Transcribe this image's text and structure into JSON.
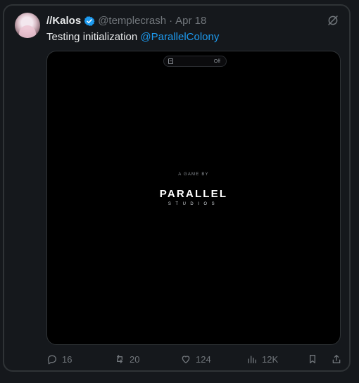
{
  "tweet": {
    "display_name": "//Kalos",
    "handle": "@templecrash",
    "separator": "·",
    "date": "Apr 18",
    "text_prefix": "Testing initialization ",
    "mention": "@ParallelColony"
  },
  "media": {
    "pill_status": "Off",
    "kicker": "A GAME BY",
    "brand": "PARALLEL",
    "studios": "STUDIOS"
  },
  "actions": {
    "replies": "16",
    "reposts": "20",
    "likes": "124",
    "views": "12K"
  },
  "colors": {
    "accent": "#1d9bf0",
    "muted": "#71767b",
    "background": "#15181c",
    "text": "#e7e9ea"
  },
  "icons": {
    "verified": "verified-badge-icon",
    "grok": "grok-icon",
    "reply": "reply-icon",
    "repost": "repost-icon",
    "like": "like-icon",
    "views": "views-icon",
    "bookmark": "bookmark-icon",
    "share": "share-icon"
  }
}
